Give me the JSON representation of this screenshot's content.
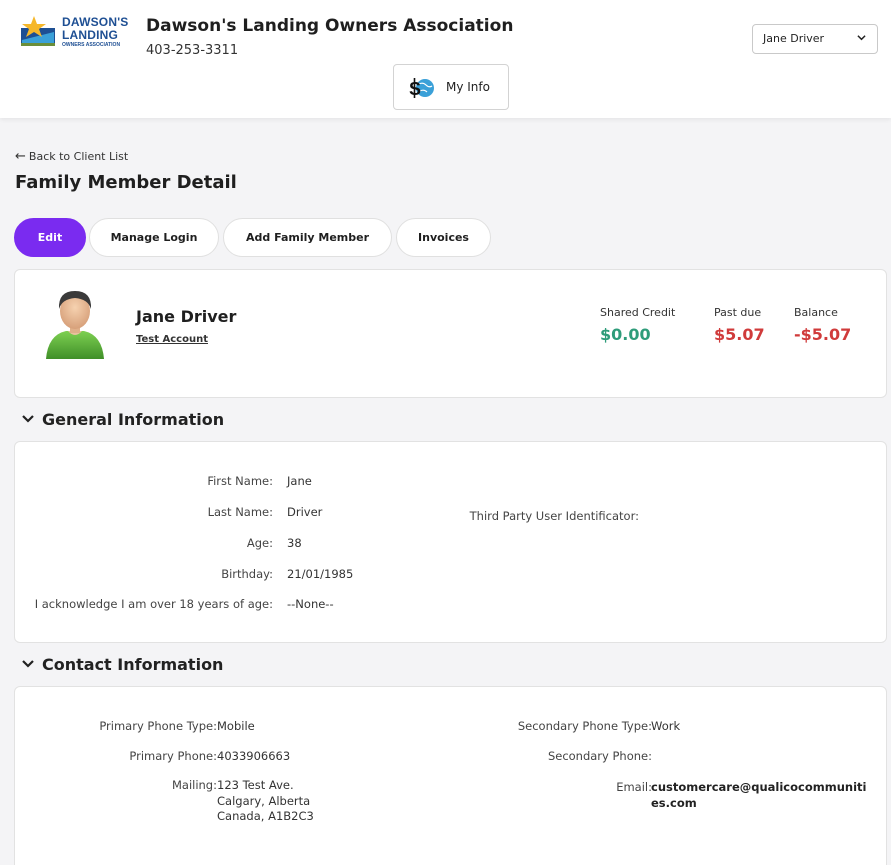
{
  "header": {
    "logo": {
      "line1": "DAWSON'S",
      "line2": "LANDING",
      "line3": "OWNERS ASSOCIATION"
    },
    "org_name": "Dawson's Landing Owners Association",
    "phone": "403-253-3311",
    "user_select": "Jane Driver",
    "my_info_label": "My Info"
  },
  "nav": {
    "back_label": "Back to Client List"
  },
  "page_title": "Family Member Detail",
  "actions": {
    "edit": "Edit",
    "manage_login": "Manage Login",
    "add_family_member": "Add Family Member",
    "invoices": "Invoices"
  },
  "summary": {
    "name": "Jane Driver",
    "account_link": "Test Account",
    "shared_credit_label": "Shared Credit",
    "shared_credit_value": "$0.00",
    "past_due_label": "Past due",
    "past_due_value": "$5.07",
    "balance_label": "Balance",
    "balance_value": "-$5.07"
  },
  "general": {
    "title": "General Information",
    "first_name_label": "First Name:",
    "first_name": "Jane",
    "last_name_label": "Last Name:",
    "last_name": "Driver",
    "age_label": "Age:",
    "age": "38",
    "birthday_label": "Birthday:",
    "birthday": "21/01/1985",
    "ack_label": "I acknowledge I am over 18 years of age:",
    "ack_value": "--None--",
    "third_party_label": "Third Party User Identificator:"
  },
  "contact": {
    "title": "Contact Information",
    "primary_type_label": "Primary Phone Type:",
    "primary_type": "Mobile",
    "primary_phone_label": "Primary Phone:",
    "primary_phone": "4033906663",
    "mailing_label": "Mailing:",
    "mailing_line1": "123 Test Ave.",
    "mailing_line2": "Calgary, Alberta",
    "mailing_line3": "Canada, A1B2C3",
    "secondary_type_label": "Secondary Phone Type:",
    "secondary_type": "Work",
    "secondary_phone_label": "Secondary Phone:",
    "email_label": "Email:",
    "email_line1": "customercare@qualicocommuniti",
    "email_line2": "es.com"
  },
  "colors": {
    "primary": "#7a2bf0",
    "credit_green": "#2e9c7a",
    "due_red": "#d03b3b",
    "logo_blue": "#1e4f93"
  }
}
